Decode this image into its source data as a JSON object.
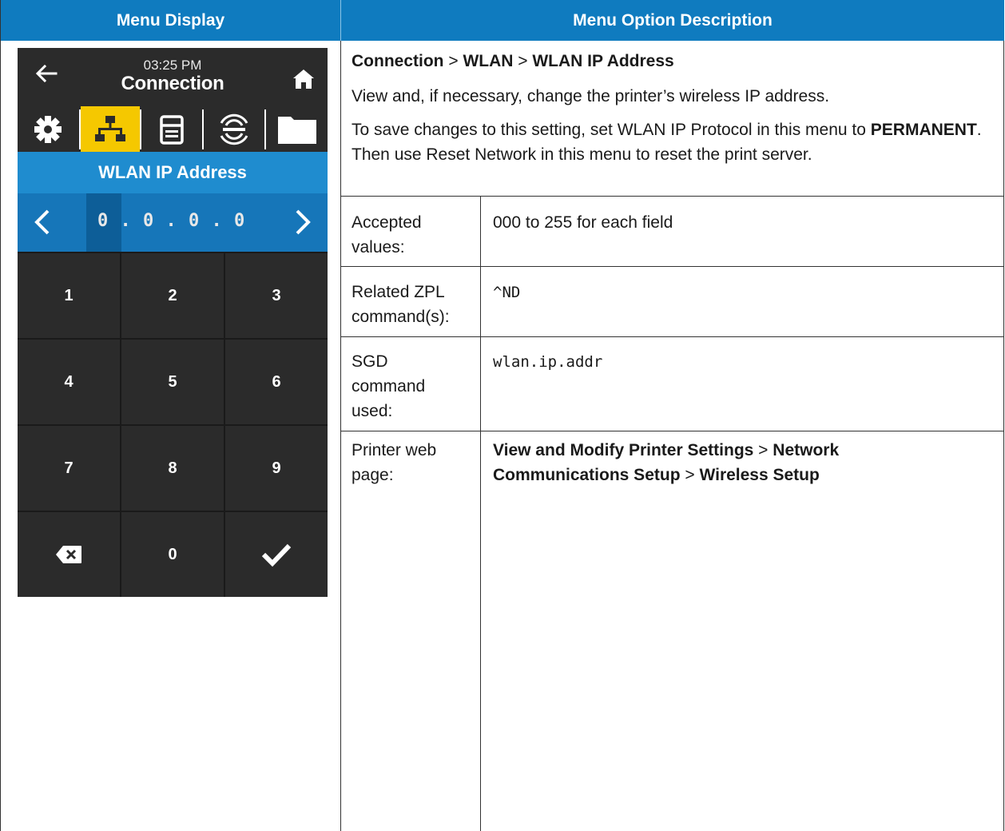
{
  "table": {
    "header_left": "Menu Display",
    "header_right": "Menu Option Description"
  },
  "screen": {
    "time": "03:25 PM",
    "title": "Connection",
    "subtitle": "WLAN IP Address",
    "ip_value": "0 . 0 . 0 . 0",
    "tabs": [
      "gear-icon",
      "network-icon",
      "printer-icon",
      "wireless-icon",
      "folder-icon"
    ],
    "active_tab": "network-icon",
    "keys": [
      "1",
      "2",
      "3",
      "4",
      "5",
      "6",
      "7",
      "8",
      "9",
      "backspace",
      "0",
      "check"
    ],
    "key_labels": {
      "k1": "1",
      "k2": "2",
      "k3": "3",
      "k4": "4",
      "k5": "5",
      "k6": "6",
      "k7": "7",
      "k8": "8",
      "k9": "9",
      "k0": "0"
    },
    "colors": {
      "accent": "#f5c800",
      "subtitle_bg": "#1f8ccf",
      "ip_bg": "#1676b9",
      "screen_bg": "#2b2b2b",
      "header_bg": "#0f7bbf"
    }
  },
  "description": {
    "breadcrumb": {
      "part1": "Connection",
      "sep1": " > ",
      "part2": "WLAN",
      "sep2": " > ",
      "part3": "WLAN IP Address"
    },
    "summary": "View and, if necessary, change the printer’s wireless IP address.",
    "note": {
      "before": "To save changes to this setting, set WLAN IP Protocol in this menu to ",
      "bold": "PERMANENT",
      "after": ". Then use Reset Network in this menu to reset the print server."
    }
  },
  "rows": {
    "accepted_label": "Accepted values:",
    "accepted_value": "000 to 255 for each field",
    "zpl_label": "Related ZPL command(s):",
    "zpl_value": "^ND",
    "sgd_label": "SGD command used:",
    "sgd_value": "wlan.ip.addr",
    "web_label": "Printer web page:",
    "web_value": {
      "part1": "View and Modify Printer Settings",
      "sep1": " > ",
      "part2": "Network Communications Setup",
      "sep2": " > ",
      "part3": "Wireless Setup"
    }
  }
}
